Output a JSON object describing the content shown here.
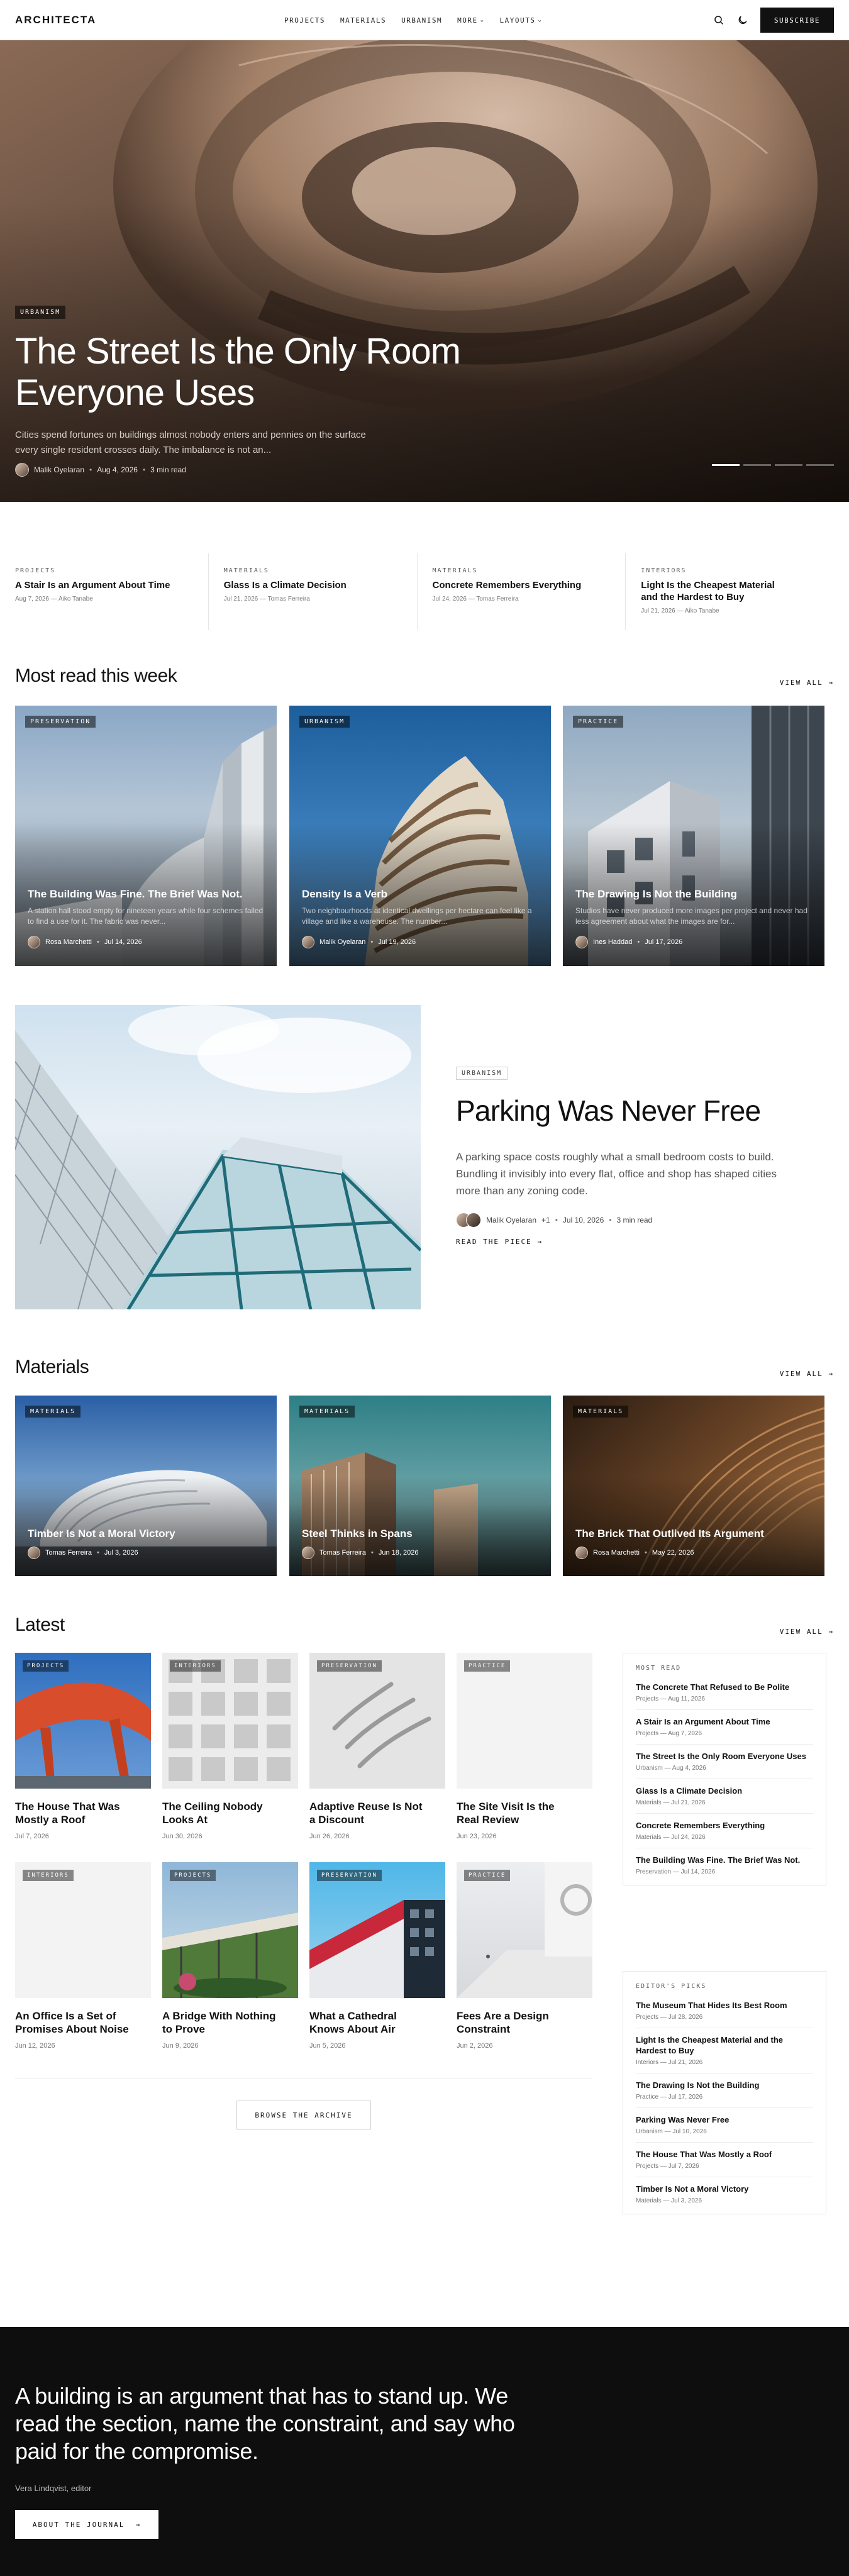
{
  "brand": {
    "logo": "ARCHITECTA"
  },
  "nav": [
    {
      "label": "PROJECTS"
    },
    {
      "label": "MATERIALS"
    },
    {
      "label": "URBANISM"
    },
    {
      "label": "MORE",
      "dropdown": true
    },
    {
      "label": "LAYOUTS",
      "dropdown": true
    }
  ],
  "header": {
    "subscribe_label": "SUBSCRIBE",
    "icons": [
      "search-icon",
      "moon-icon"
    ]
  },
  "hero": {
    "tag": "URBANISM",
    "title": "The Street Is the Only Room Everyone Uses",
    "excerpt": "Cities spend fortunes on buildings almost nobody enters and pennies on the surface every single resident crosses daily. The imbalance is not an...",
    "author": "Malik Oyelaran",
    "date": "Aug 4, 2026",
    "read_time": "3 min read",
    "slides": 4,
    "active_slide": 1
  },
  "strip": [
    {
      "kicker": "PROJECTS",
      "title": "A Stair Is an Argument About Time",
      "meta": "Aug 7, 2026 — Aiko Tanabe"
    },
    {
      "kicker": "MATERIALS",
      "title": "Glass Is a Climate Decision",
      "meta": "Jul 21, 2026 — Tomas Ferreira"
    },
    {
      "kicker": "MATERIALS",
      "title": "Concrete Remembers Everything",
      "meta": "Jul 24, 2026 — Tomas Ferreira"
    },
    {
      "kicker": "INTERIORS",
      "title": "Light Is the Cheapest Material and the Hardest to Buy",
      "meta": "Jul 21, 2026 — Aiko Tanabe"
    }
  ],
  "most_read": {
    "heading": "Most read this week",
    "view_all": "VIEW ALL",
    "cards": [
      {
        "tag": "PRESERVATION",
        "title": "The Building Was Fine. The Brief Was Not.",
        "excerpt": "A station hall stood empty for nineteen years while four schemes failed to find a use for it. The fabric was never...",
        "author": "Rosa Marchetti",
        "date": "Jul 14, 2026"
      },
      {
        "tag": "URBANISM",
        "title": "Density Is a Verb",
        "excerpt": "Two neighbourhoods at identical dwellings per hectare can feel like a village and like a warehouse. The number...",
        "author": "Malik Oyelaran",
        "date": "Jul 19, 2026"
      },
      {
        "tag": "PRACTICE",
        "title": "The Drawing Is Not the Building",
        "excerpt": "Studios have never produced more images per project and never had less agreement about what the images are for...",
        "author": "Ines Haddad",
        "date": "Jul 17, 2026"
      }
    ]
  },
  "feature": {
    "tag": "URBANISM",
    "title": "Parking Was Never Free",
    "excerpt": "A parking space costs roughly what a small bedroom costs to build. Bundling it invisibly into every flat, office and shop has shaped cities more than any zoning code.",
    "author": "Malik Oyelaran",
    "coauthors": "+1",
    "date": "Jul 10, 2026",
    "read_time": "3 min read",
    "link": "READ THE PIECE"
  },
  "materials": {
    "heading": "Materials",
    "view_all": "VIEW ALL",
    "cards": [
      {
        "tag": "MATERIALS",
        "title": "Timber Is Not a Moral Victory",
        "author": "Tomas Ferreira",
        "date": "Jul 3, 2026"
      },
      {
        "tag": "MATERIALS",
        "title": "Steel Thinks in Spans",
        "author": "Tomas Ferreira",
        "date": "Jun 18, 2026"
      },
      {
        "tag": "MATERIALS",
        "title": "The Brick That Outlived Its Argument",
        "author": "Rosa Marchetti",
        "date": "May 22, 2026"
      }
    ]
  },
  "latest": {
    "heading": "Latest",
    "view_all": "VIEW ALL",
    "cards": [
      {
        "tag": "PROJECTS",
        "title": "The House That Was Mostly a Roof",
        "date": "Jul 7, 2026"
      },
      {
        "tag": "INTERIORS",
        "title": "The Ceiling Nobody Looks At",
        "date": "Jun 30, 2026"
      },
      {
        "tag": "PRESERVATION",
        "title": "Adaptive Reuse Is Not a Discount",
        "date": "Jun 26, 2026"
      },
      {
        "tag": "PRACTICE",
        "title": "The Site Visit Is the Real Review",
        "date": "Jun 23, 2026"
      },
      {
        "tag": "INTERIORS",
        "title": "An Office Is a Set of Promises About Noise",
        "date": "Jun 12, 2026"
      },
      {
        "tag": "PROJECTS",
        "title": "A Bridge With Nothing to Prove",
        "date": "Jun 9, 2026"
      },
      {
        "tag": "PRESERVATION",
        "title": "What a Cathedral Knows About Air",
        "date": "Jun 5, 2026"
      },
      {
        "tag": "PRACTICE",
        "title": "Fees Are a Design Constraint",
        "date": "Jun 2, 2026"
      }
    ],
    "archive_label": "BROWSE THE ARCHIVE"
  },
  "sidebar": {
    "most_read": {
      "heading": "MOST READ",
      "items": [
        {
          "title": "The Concrete That Refused to Be Polite",
          "meta": "Projects — Aug 11, 2026"
        },
        {
          "title": "A Stair Is an Argument About Time",
          "meta": "Projects — Aug 7, 2026"
        },
        {
          "title": "The Street Is the Only Room Everyone Uses",
          "meta": "Urbanism — Aug 4, 2026"
        },
        {
          "title": "Glass Is a Climate Decision",
          "meta": "Materials — Jul 21, 2026"
        },
        {
          "title": "Concrete Remembers Everything",
          "meta": "Materials — Jul 24, 2026"
        },
        {
          "title": "The Building Was Fine. The Brief Was Not.",
          "meta": "Preservation — Jul 14, 2026"
        }
      ]
    },
    "editors_picks": {
      "heading": "EDITOR'S PICKS",
      "items": [
        {
          "title": "The Museum That Hides Its Best Room",
          "meta": "Projects — Jul 28, 2026"
        },
        {
          "title": "Light Is the Cheapest Material and the Hardest to Buy",
          "meta": "Interiors — Jul 21, 2026"
        },
        {
          "title": "The Drawing Is Not the Building",
          "meta": "Practice — Jul 17, 2026"
        },
        {
          "title": "Parking Was Never Free",
          "meta": "Urbanism — Jul 10, 2026"
        },
        {
          "title": "The House That Was Mostly a Roof",
          "meta": "Projects — Jul 7, 2026"
        },
        {
          "title": "Timber Is Not a Moral Victory",
          "meta": "Materials — Jul 3, 2026"
        }
      ]
    }
  },
  "footer": {
    "quote": "A building is an argument that has to stand up. We read the section, name the constraint, and say who paid for the compromise.",
    "author": "Vera Lindqvist, editor",
    "button": "ABOUT THE JOURNAL"
  }
}
